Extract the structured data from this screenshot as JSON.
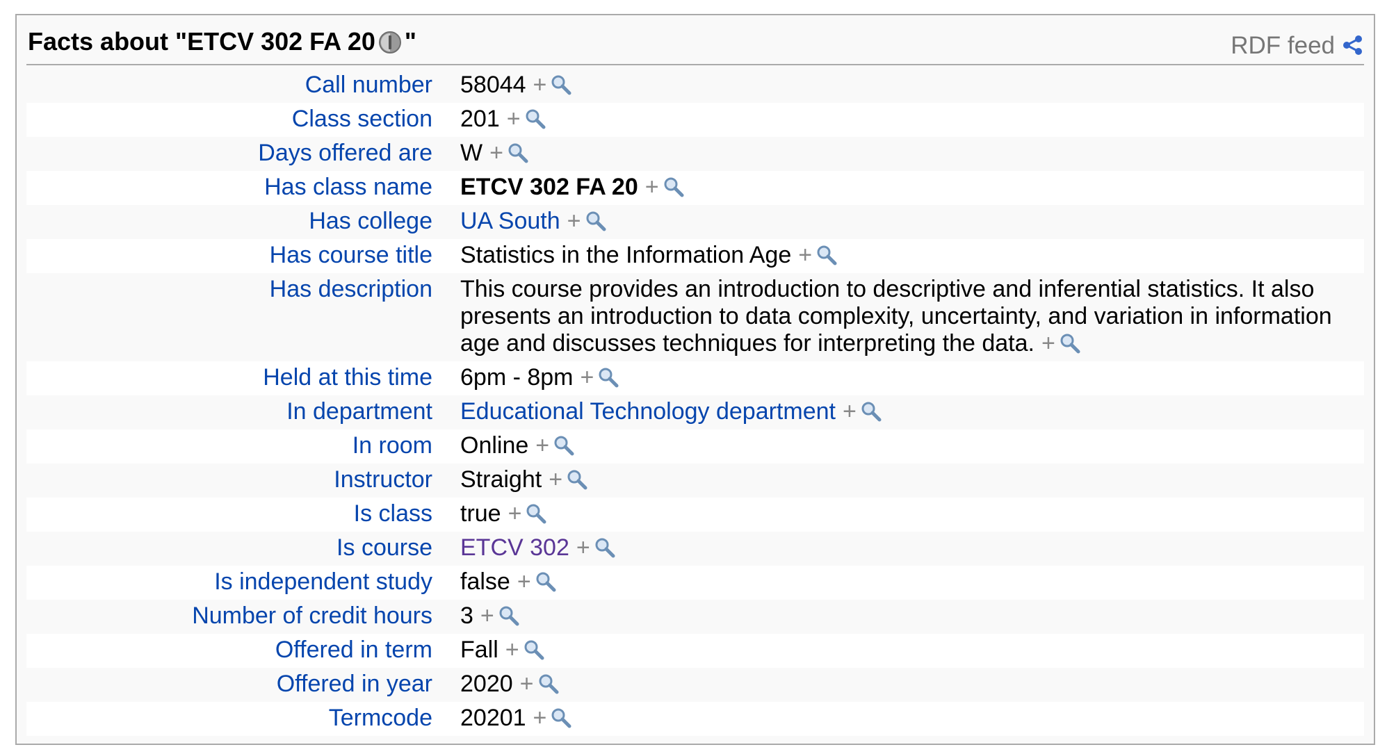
{
  "factbox": {
    "title_prefix": "Facts about \"ETCV 302 FA 20",
    "title_suffix": "\"",
    "info_icon": "info-icon",
    "rdf_label": "RDF feed",
    "share_icon": "share-icon"
  },
  "search_icon": "search-icon",
  "plus_label": "+",
  "facts": [
    {
      "prop": "Call number",
      "value": "58044",
      "style": "text"
    },
    {
      "prop": "Class section",
      "value": "201",
      "style": "text"
    },
    {
      "prop": "Days offered are",
      "value": "W",
      "style": "text"
    },
    {
      "prop": "Has class name",
      "value": "ETCV 302 FA 20",
      "style": "bold"
    },
    {
      "prop": "Has college",
      "value": "UA South",
      "style": "link"
    },
    {
      "prop": "Has course title",
      "value": "Statistics in the Information Age",
      "style": "text"
    },
    {
      "prop": "Has description",
      "value": "This course provides an introduction to descriptive and inferential statistics. It also presents an introduction to data complexity, uncertainty, and variation in information age and discusses techniques for interpreting the data.",
      "style": "text"
    },
    {
      "prop": "Held at this time",
      "value": "6pm - 8pm",
      "style": "text"
    },
    {
      "prop": "In department",
      "value": "Educational Technology department",
      "style": "link"
    },
    {
      "prop": "In room",
      "value": "Online",
      "style": "text"
    },
    {
      "prop": "Instructor",
      "value": "Straight",
      "style": "text"
    },
    {
      "prop": "Is class",
      "value": "true",
      "style": "text"
    },
    {
      "prop": "Is course",
      "value": "ETCV 302",
      "style": "visited"
    },
    {
      "prop": "Is independent study",
      "value": "false",
      "style": "text"
    },
    {
      "prop": "Number of credit hours",
      "value": "3",
      "style": "text"
    },
    {
      "prop": "Offered in term",
      "value": "Fall",
      "style": "text"
    },
    {
      "prop": "Offered in year",
      "value": "2020",
      "style": "text"
    },
    {
      "prop": "Termcode",
      "value": "20201",
      "style": "text"
    }
  ],
  "colors": {
    "link": "#0645ad",
    "visited_link": "#5a3696",
    "muted": "#888888",
    "border": "#aaaaaa",
    "row_alt": "#ffffff",
    "row_bg": "#f9f9f9"
  }
}
